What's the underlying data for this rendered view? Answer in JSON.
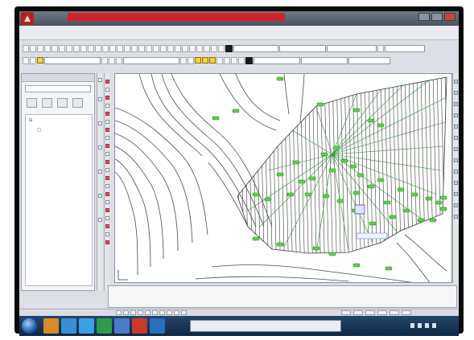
{
  "window": {
    "title": "",
    "controls": {
      "minimize": "",
      "maximize": "",
      "close": ""
    }
  },
  "menu": {
    "items": [
      "",
      "",
      "",
      "",
      "",
      "",
      "",
      "",
      "",
      "",
      "",
      "",
      "",
      "",
      "",
      "",
      "",
      "",
      "",
      "",
      "",
      "",
      "",
      "",
      "",
      "",
      ""
    ]
  },
  "toolbar": {
    "layer_combo": "",
    "linetype_combo": "",
    "style_combo": "",
    "layer_name": "",
    "color_combo": "",
    "linetype_combo2": "",
    "lineweight_combo": ""
  },
  "panel": {
    "title": "",
    "field": "",
    "tree_root": "",
    "tree_child": ""
  },
  "drawing": {
    "label_left": "",
    "label_mid": "",
    "hatch_color": "#2f8f39",
    "marker_color": "#5cd14b",
    "contour_color": "#4a4a4a"
  },
  "command": {
    "line1": "",
    "line2": "",
    "line3": ""
  },
  "status": {
    "coords": ""
  },
  "taskbar": {
    "search_text": "",
    "clock_time": "",
    "clock_date": ""
  }
}
